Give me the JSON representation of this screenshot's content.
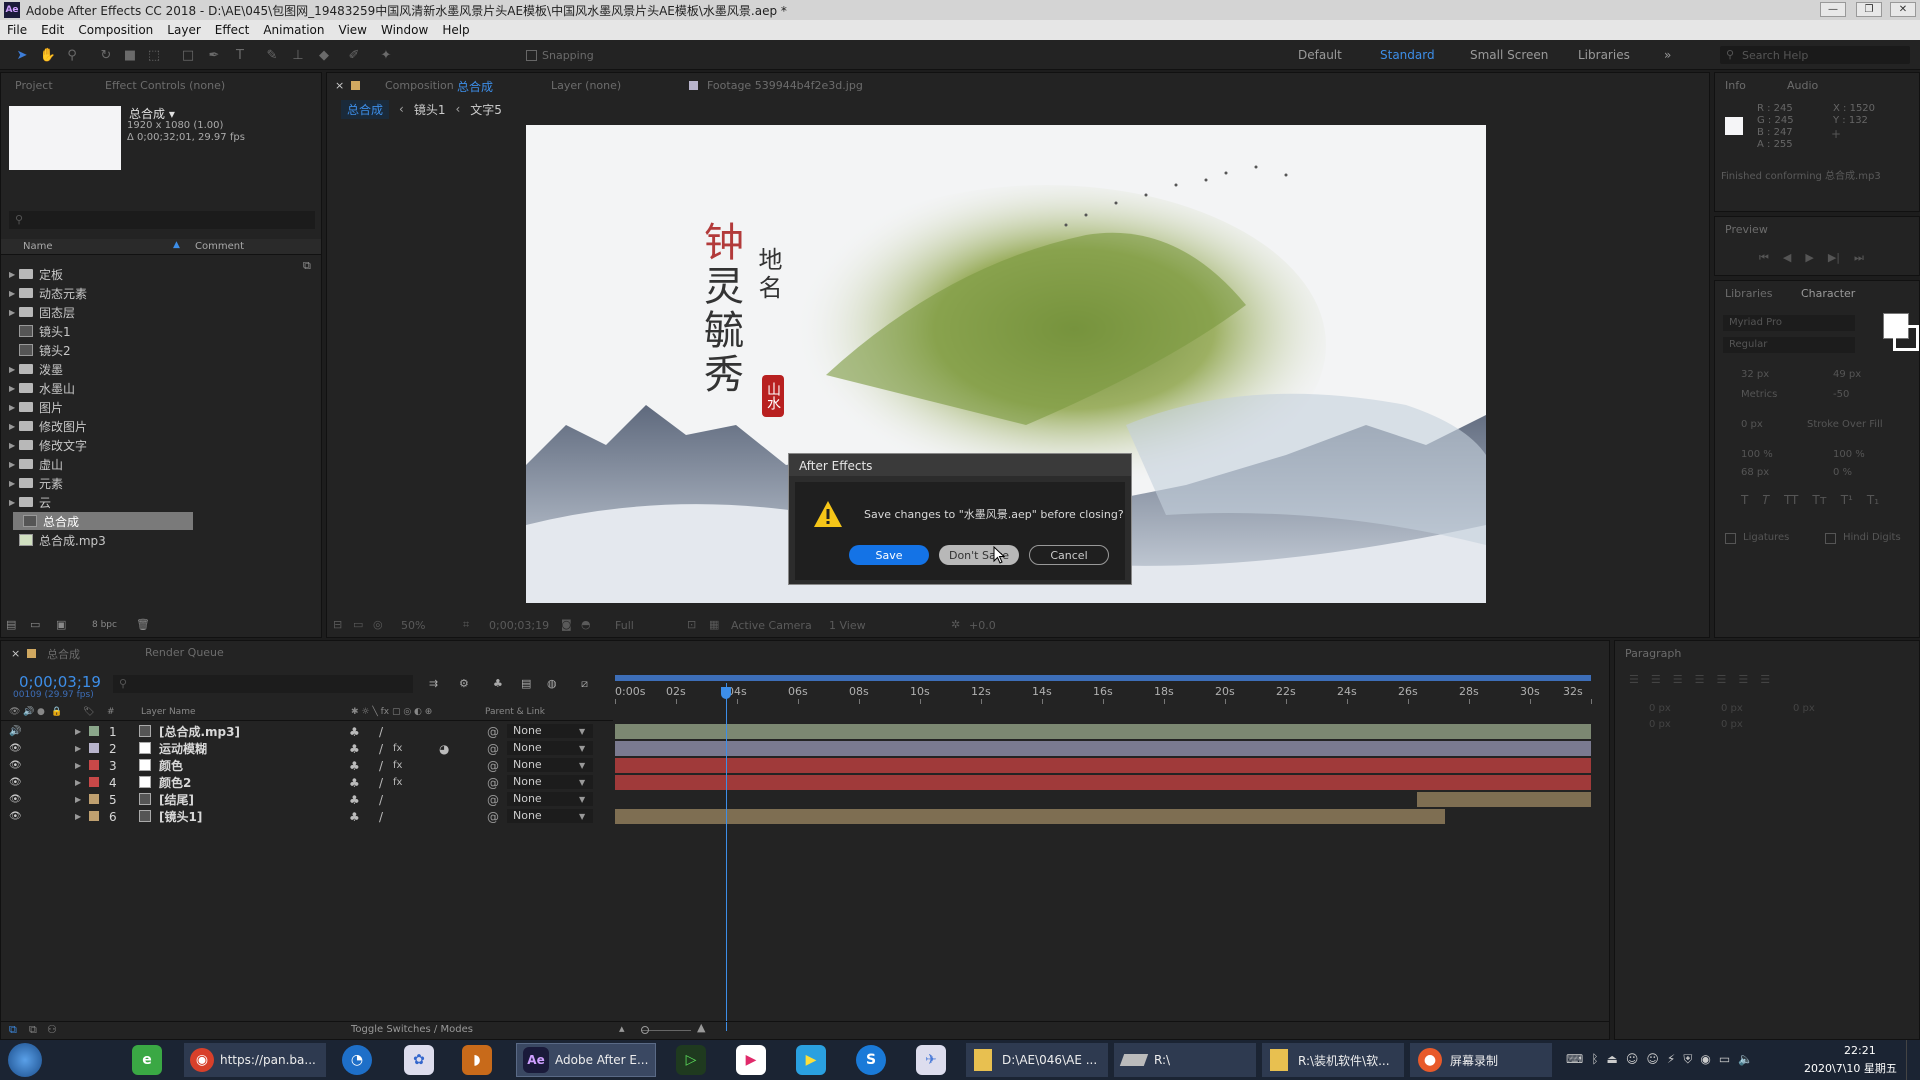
{
  "window": {
    "title": "Adobe After Effects CC 2018 - D:\\AE\\045\\包图网_19483259中国风清新水墨风景片头AE模板\\中国风水墨风景片头AE模板\\水墨风景.aep *",
    "app_icon": "Ae"
  },
  "menu": [
    "File",
    "Edit",
    "Composition",
    "Layer",
    "Effect",
    "Animation",
    "View",
    "Window",
    "Help"
  ],
  "toolbar": {
    "snapping_label": "Snapping",
    "workspaces": [
      "Default",
      "Standard",
      "Small Screen",
      "Libraries"
    ],
    "active_workspace": "Standard",
    "search_placeholder": "Search Help"
  },
  "project_panel": {
    "tab": "Project",
    "tab2": "Effect Controls (none)",
    "comp_name": "总合成 ▾",
    "comp_info1": "1920 x 1080 (1.00)",
    "comp_info2": "Δ 0;00;32;01, 29.97 fps",
    "col_name": "Name",
    "col_comment": "Comment",
    "items": [
      {
        "label": "定板",
        "type": "folder"
      },
      {
        "label": "动态元素",
        "type": "folder"
      },
      {
        "label": "固态层",
        "type": "folder"
      },
      {
        "label": "镜头1",
        "type": "comp"
      },
      {
        "label": "镜头2",
        "type": "comp"
      },
      {
        "label": "泼墨",
        "type": "folder"
      },
      {
        "label": "水墨山",
        "type": "folder"
      },
      {
        "label": "图片",
        "type": "folder"
      },
      {
        "label": "修改图片",
        "type": "folder"
      },
      {
        "label": "修改文字",
        "type": "folder"
      },
      {
        "label": "虚山",
        "type": "folder"
      },
      {
        "label": "元素",
        "type": "folder"
      },
      {
        "label": "云",
        "type": "folder"
      },
      {
        "label": "总合成",
        "type": "comp",
        "selected": true
      },
      {
        "label": "总合成.mp3",
        "type": "audio"
      }
    ],
    "bpc": "8 bpc"
  },
  "comp_viewer": {
    "tab_composition": "Composition",
    "tab_comp_name": "总合成",
    "tab_layer": "Layer (none)",
    "tab_footage": "Footage 539944b4f2e3d.jpg",
    "breadcrumbs": [
      "总合成",
      "镜头1",
      "文字5"
    ],
    "zoom": "50%",
    "timecode": "0;00;03;19",
    "resolution": "Full",
    "camera": "Active Camera",
    "views": "1 View",
    "exposure": "+0.0",
    "scene_title_chars": [
      "钟",
      "灵",
      "毓",
      "秀"
    ],
    "scene_place": [
      "地",
      "名"
    ],
    "scene_seal": "山水"
  },
  "dialog": {
    "title": "After Effects",
    "message": "Save changes to \"水墨风景.aep\" before closing?",
    "save": "Save",
    "dont_save": "Don't Save",
    "cancel": "Cancel"
  },
  "info_panel": {
    "tab": "Info",
    "tab2": "Audio",
    "r": "R : 245",
    "g": "G : 245",
    "b": "B : 247",
    "a": "A : 255",
    "x": "X : 1520",
    "y": "Y : 132",
    "status": "Finished conforming 总合成.mp3"
  },
  "preview_panel": {
    "tab": "Preview"
  },
  "character_panel": {
    "tab_libraries": "Libraries",
    "tab": "Character",
    "font": "Myriad Pro",
    "style": "Regular",
    "size": "32 px",
    "leading": "49 px",
    "kerning": "Metrics",
    "tracking": "-50",
    "stroke": "0 px",
    "stroke_mode": "Stroke Over Fill",
    "vscale": "100 %",
    "hscale": "100 %",
    "baseline": "68 px",
    "tsume": "0 %",
    "ligatures": "Ligatures",
    "hindi": "Hindi Digits"
  },
  "paragraph_panel": {
    "tab": "Paragraph",
    "vals": [
      "0 px",
      "0 px",
      "0 px",
      "0 px",
      "0 px"
    ]
  },
  "timeline": {
    "tab": "总合成",
    "tab2": "Render Queue",
    "timecode": "0;00;03;19",
    "frame": "00109 (29.97 fps)",
    "col_layer_name": "Layer Name",
    "col_parent": "Parent & Link",
    "ticks": [
      "0:00s",
      "02s",
      "04s",
      "06s",
      "08s",
      "10s",
      "12s",
      "14s",
      "16s",
      "18s",
      "20s",
      "22s",
      "24s",
      "26s",
      "28s",
      "30s",
      "32s"
    ],
    "layers": [
      {
        "num": "1",
        "name": "[总合成.mp3]",
        "color": "#8aa68a",
        "parent": "None",
        "bar_color": "#7c8872",
        "start": 0,
        "end": 32
      },
      {
        "num": "2",
        "name": "运动模糊",
        "color": "#b8b4cc",
        "parent": "None",
        "bar_color": "#7a7a90",
        "start": 0,
        "end": 32
      },
      {
        "num": "3",
        "name": "颜色",
        "color": "#c84848",
        "parent": "None",
        "bar_color": "#a03a3a",
        "start": 0,
        "end": 32
      },
      {
        "num": "4",
        "name": "颜色2",
        "color": "#c84848",
        "parent": "None",
        "bar_color": "#a03a3a",
        "start": 0,
        "end": 32
      },
      {
        "num": "5",
        "name": "[结尾]",
        "color": "#bfa070",
        "parent": "None",
        "bar_color": "#7e6e52",
        "start": 26.3,
        "end": 32
      },
      {
        "num": "6",
        "name": "[镜头1]",
        "color": "#bfa070",
        "parent": "None",
        "bar_color": "#7e6e52",
        "start": 0,
        "end": 27.2
      }
    ],
    "playhead": 3.63,
    "duration": 32,
    "toggle_label": "Toggle Switches / Modes"
  },
  "taskbar": {
    "items": [
      {
        "label": "https://pan.ba...",
        "icon": "chrome-icon"
      },
      {
        "label": "Adobe After E...",
        "icon": "ae-icon"
      },
      {
        "label": "D:\\AE\\046\\AE ...",
        "icon": "folder-icon"
      },
      {
        "label": "R:\\",
        "icon": "drive-icon"
      },
      {
        "label": "R:\\装机软件\\软...",
        "icon": "folder-icon"
      },
      {
        "label": "屏幕录制",
        "icon": "record-icon"
      }
    ],
    "clock_time": "22:21",
    "clock_date": "2020\\7\\10 星期五"
  }
}
